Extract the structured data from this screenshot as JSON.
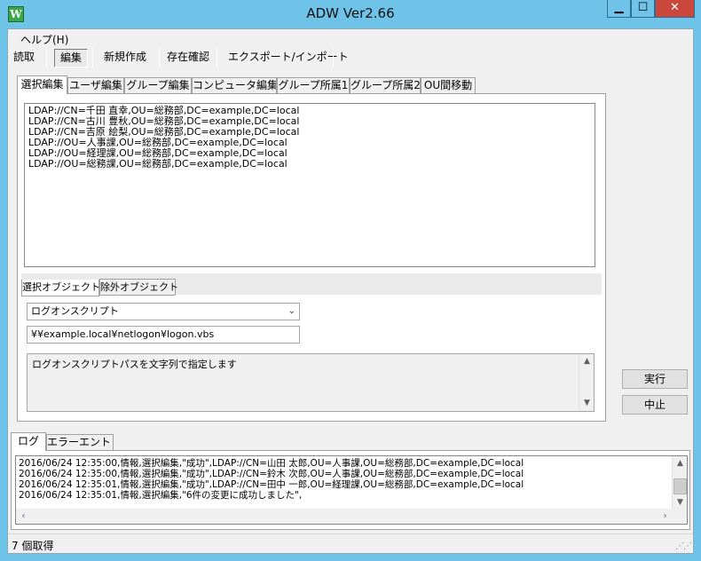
{
  "window": {
    "title": "ADW Ver2.66",
    "icon_letter": "W",
    "min_glyph": "▁",
    "max_glyph": "☐",
    "close_glyph": "✕"
  },
  "menu": {
    "help": "ヘルプ(H)"
  },
  "toolbar": {
    "read": "読取",
    "edit": "編集",
    "new": "新規作成",
    "exists": "存在確認",
    "export_import": "エクスポート/インポート"
  },
  "main_tabs": [
    "選択編集",
    "ユーザ編集",
    "グループ編集",
    "コンピュータ編集",
    "グループ所属1",
    "グループ所属2",
    "OU間移動"
  ],
  "ldap_objects": [
    "LDAP://CN=千田 直幸,OU=総務部,DC=example,DC=local",
    "LDAP://CN=古川 豊秋,OU=総務部,DC=example,DC=local",
    "LDAP://CN=吉原 絵梨,OU=総務部,DC=example,DC=local",
    "LDAP://OU=人事課,OU=総務部,DC=example,DC=local",
    "LDAP://OU=経理課,OU=総務部,DC=example,DC=local",
    "LDAP://OU=総務課,OU=総務部,DC=example,DC=local"
  ],
  "object_tabs": {
    "selected": "選択オブジェクト",
    "excluded": "除外オブジェクト"
  },
  "attribute_select": {
    "value": "ログオンスクリプト",
    "arrow": "⌄"
  },
  "path_input": {
    "value": "¥¥example.local¥netlogon¥logon.vbs"
  },
  "description": "ログオンスクリプトパスを文字列で指定します",
  "buttons": {
    "run": "実行",
    "stop": "中止"
  },
  "log_tabs": {
    "log": "ログ",
    "error": "エラーエントリ"
  },
  "log_lines": [
    "2016/06/24 12:35:00,情報,選択編集,\"成功\",LDAP://CN=山田 太郎,OU=人事課,OU=総務部,DC=example,DC=local",
    "2016/06/24 12:35:00,情報,選択編集,\"成功\",LDAP://CN=鈴木 次郎,OU=人事課,OU=総務部,DC=example,DC=local",
    "2016/06/24 12:35:01,情報,選択編集,\"成功\",LDAP://CN=田中 一郎,OU=経理課,OU=総務部,DC=example,DC=local",
    "2016/06/24 12:35:01,情報,選択編集,\"6件の変更に成功しました\","
  ],
  "scroll_glyphs": {
    "up": "▲",
    "down": "▼",
    "left": "‹",
    "right": "›"
  },
  "status": {
    "text": "7 個取得",
    "grip": "⋰⋰"
  }
}
